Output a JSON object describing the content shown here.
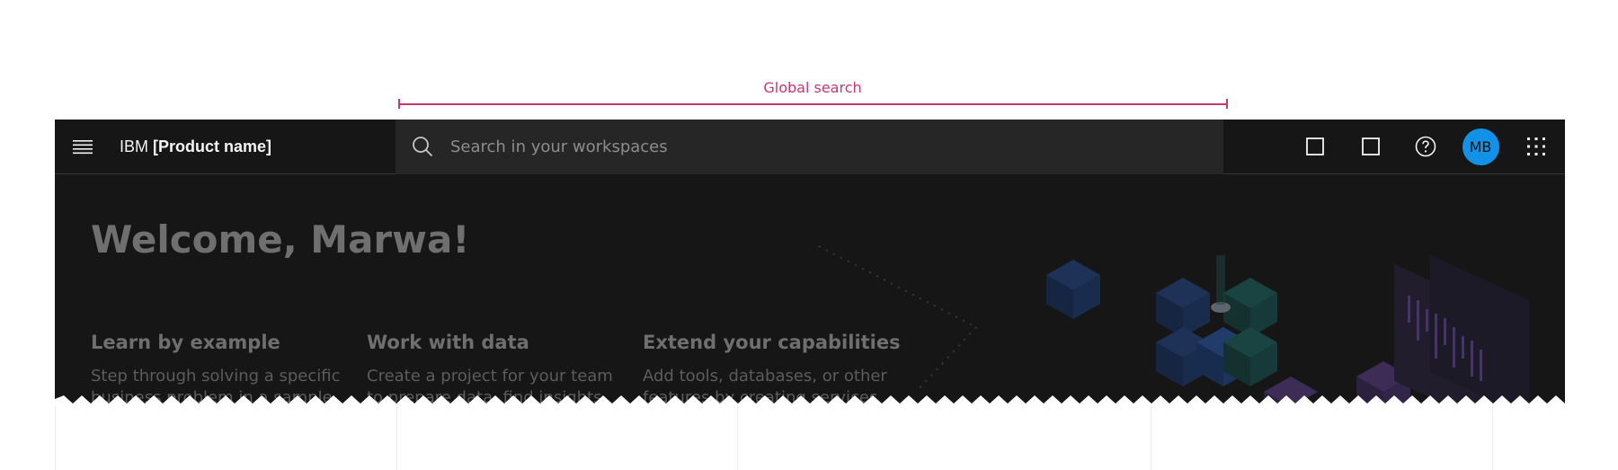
{
  "annotation": {
    "label": "Global search"
  },
  "header": {
    "brand_prefix": "IBM",
    "brand_product": "[Product name]",
    "search_placeholder": "Search in your workspaces",
    "avatar_initials": "MB"
  },
  "page": {
    "welcome": "Welcome, Marwa!",
    "columns": [
      {
        "title": "Learn by example",
        "body": "Step through solving a specific business problem in a sample"
      },
      {
        "title": "Work with data",
        "body": "Create a project for your team to prepare data, find insights, or"
      },
      {
        "title": "Extend your capabilities",
        "body": "Add tools, databases, or other features by creating services"
      }
    ]
  },
  "colors": {
    "annotation": "#c8386e",
    "shell_background": "#161616",
    "search_background": "#262626",
    "avatar": "#1192e8"
  }
}
